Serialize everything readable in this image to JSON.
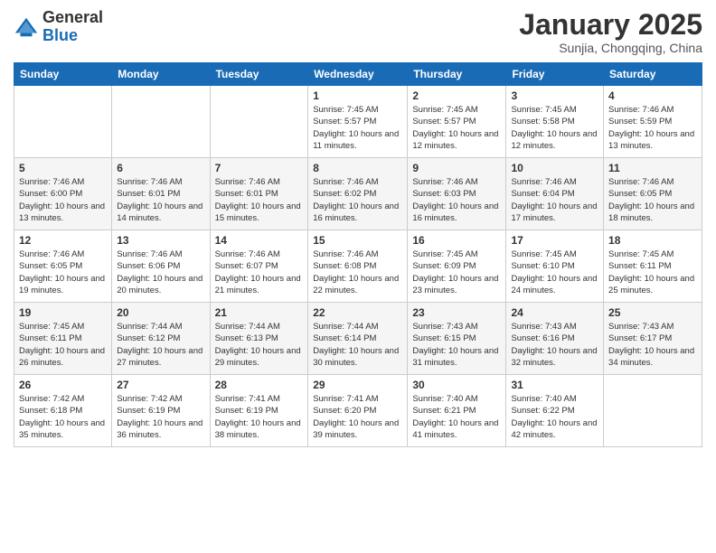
{
  "logo": {
    "general": "General",
    "blue": "Blue"
  },
  "title": "January 2025",
  "subtitle": "Sunjia, Chongqing, China",
  "days_header": [
    "Sunday",
    "Monday",
    "Tuesday",
    "Wednesday",
    "Thursday",
    "Friday",
    "Saturday"
  ],
  "weeks": [
    [
      {
        "day": "",
        "sunrise": "",
        "sunset": "",
        "daylight": ""
      },
      {
        "day": "",
        "sunrise": "",
        "sunset": "",
        "daylight": ""
      },
      {
        "day": "",
        "sunrise": "",
        "sunset": "",
        "daylight": ""
      },
      {
        "day": "1",
        "sunrise": "Sunrise: 7:45 AM",
        "sunset": "Sunset: 5:57 PM",
        "daylight": "Daylight: 10 hours and 11 minutes."
      },
      {
        "day": "2",
        "sunrise": "Sunrise: 7:45 AM",
        "sunset": "Sunset: 5:57 PM",
        "daylight": "Daylight: 10 hours and 12 minutes."
      },
      {
        "day": "3",
        "sunrise": "Sunrise: 7:45 AM",
        "sunset": "Sunset: 5:58 PM",
        "daylight": "Daylight: 10 hours and 12 minutes."
      },
      {
        "day": "4",
        "sunrise": "Sunrise: 7:46 AM",
        "sunset": "Sunset: 5:59 PM",
        "daylight": "Daylight: 10 hours and 13 minutes."
      }
    ],
    [
      {
        "day": "5",
        "sunrise": "Sunrise: 7:46 AM",
        "sunset": "Sunset: 6:00 PM",
        "daylight": "Daylight: 10 hours and 13 minutes."
      },
      {
        "day": "6",
        "sunrise": "Sunrise: 7:46 AM",
        "sunset": "Sunset: 6:01 PM",
        "daylight": "Daylight: 10 hours and 14 minutes."
      },
      {
        "day": "7",
        "sunrise": "Sunrise: 7:46 AM",
        "sunset": "Sunset: 6:01 PM",
        "daylight": "Daylight: 10 hours and 15 minutes."
      },
      {
        "day": "8",
        "sunrise": "Sunrise: 7:46 AM",
        "sunset": "Sunset: 6:02 PM",
        "daylight": "Daylight: 10 hours and 16 minutes."
      },
      {
        "day": "9",
        "sunrise": "Sunrise: 7:46 AM",
        "sunset": "Sunset: 6:03 PM",
        "daylight": "Daylight: 10 hours and 16 minutes."
      },
      {
        "day": "10",
        "sunrise": "Sunrise: 7:46 AM",
        "sunset": "Sunset: 6:04 PM",
        "daylight": "Daylight: 10 hours and 17 minutes."
      },
      {
        "day": "11",
        "sunrise": "Sunrise: 7:46 AM",
        "sunset": "Sunset: 6:05 PM",
        "daylight": "Daylight: 10 hours and 18 minutes."
      }
    ],
    [
      {
        "day": "12",
        "sunrise": "Sunrise: 7:46 AM",
        "sunset": "Sunset: 6:05 PM",
        "daylight": "Daylight: 10 hours and 19 minutes."
      },
      {
        "day": "13",
        "sunrise": "Sunrise: 7:46 AM",
        "sunset": "Sunset: 6:06 PM",
        "daylight": "Daylight: 10 hours and 20 minutes."
      },
      {
        "day": "14",
        "sunrise": "Sunrise: 7:46 AM",
        "sunset": "Sunset: 6:07 PM",
        "daylight": "Daylight: 10 hours and 21 minutes."
      },
      {
        "day": "15",
        "sunrise": "Sunrise: 7:46 AM",
        "sunset": "Sunset: 6:08 PM",
        "daylight": "Daylight: 10 hours and 22 minutes."
      },
      {
        "day": "16",
        "sunrise": "Sunrise: 7:45 AM",
        "sunset": "Sunset: 6:09 PM",
        "daylight": "Daylight: 10 hours and 23 minutes."
      },
      {
        "day": "17",
        "sunrise": "Sunrise: 7:45 AM",
        "sunset": "Sunset: 6:10 PM",
        "daylight": "Daylight: 10 hours and 24 minutes."
      },
      {
        "day": "18",
        "sunrise": "Sunrise: 7:45 AM",
        "sunset": "Sunset: 6:11 PM",
        "daylight": "Daylight: 10 hours and 25 minutes."
      }
    ],
    [
      {
        "day": "19",
        "sunrise": "Sunrise: 7:45 AM",
        "sunset": "Sunset: 6:11 PM",
        "daylight": "Daylight: 10 hours and 26 minutes."
      },
      {
        "day": "20",
        "sunrise": "Sunrise: 7:44 AM",
        "sunset": "Sunset: 6:12 PM",
        "daylight": "Daylight: 10 hours and 27 minutes."
      },
      {
        "day": "21",
        "sunrise": "Sunrise: 7:44 AM",
        "sunset": "Sunset: 6:13 PM",
        "daylight": "Daylight: 10 hours and 29 minutes."
      },
      {
        "day": "22",
        "sunrise": "Sunrise: 7:44 AM",
        "sunset": "Sunset: 6:14 PM",
        "daylight": "Daylight: 10 hours and 30 minutes."
      },
      {
        "day": "23",
        "sunrise": "Sunrise: 7:43 AM",
        "sunset": "Sunset: 6:15 PM",
        "daylight": "Daylight: 10 hours and 31 minutes."
      },
      {
        "day": "24",
        "sunrise": "Sunrise: 7:43 AM",
        "sunset": "Sunset: 6:16 PM",
        "daylight": "Daylight: 10 hours and 32 minutes."
      },
      {
        "day": "25",
        "sunrise": "Sunrise: 7:43 AM",
        "sunset": "Sunset: 6:17 PM",
        "daylight": "Daylight: 10 hours and 34 minutes."
      }
    ],
    [
      {
        "day": "26",
        "sunrise": "Sunrise: 7:42 AM",
        "sunset": "Sunset: 6:18 PM",
        "daylight": "Daylight: 10 hours and 35 minutes."
      },
      {
        "day": "27",
        "sunrise": "Sunrise: 7:42 AM",
        "sunset": "Sunset: 6:19 PM",
        "daylight": "Daylight: 10 hours and 36 minutes."
      },
      {
        "day": "28",
        "sunrise": "Sunrise: 7:41 AM",
        "sunset": "Sunset: 6:19 PM",
        "daylight": "Daylight: 10 hours and 38 minutes."
      },
      {
        "day": "29",
        "sunrise": "Sunrise: 7:41 AM",
        "sunset": "Sunset: 6:20 PM",
        "daylight": "Daylight: 10 hours and 39 minutes."
      },
      {
        "day": "30",
        "sunrise": "Sunrise: 7:40 AM",
        "sunset": "Sunset: 6:21 PM",
        "daylight": "Daylight: 10 hours and 41 minutes."
      },
      {
        "day": "31",
        "sunrise": "Sunrise: 7:40 AM",
        "sunset": "Sunset: 6:22 PM",
        "daylight": "Daylight: 10 hours and 42 minutes."
      },
      {
        "day": "",
        "sunrise": "",
        "sunset": "",
        "daylight": ""
      }
    ]
  ]
}
